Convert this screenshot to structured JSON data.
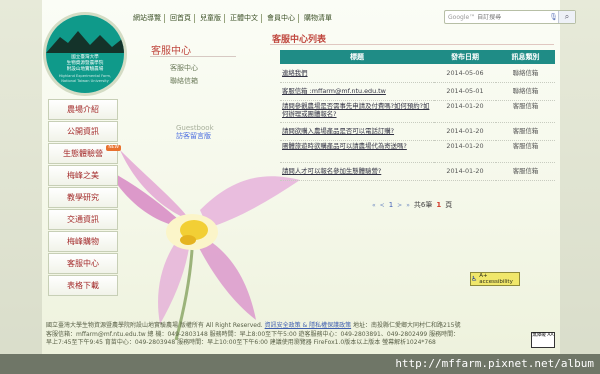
{
  "topnav": [
    "網站導覽",
    "回首頁",
    "兒童版",
    "正體中文",
    "會員中心",
    "購物清單"
  ],
  "search": {
    "google_label": "Google™",
    "placeholder": "自訂搜尋"
  },
  "logo": {
    "title_lines": [
      "國立臺灣大學",
      "生物資源暨農學院",
      "附設山地實驗農場"
    ],
    "subtitle": "Highland Experimental Farm, National Taiwan University"
  },
  "sidemenu": [
    {
      "label": "農場介紹"
    },
    {
      "label": "公開資訊"
    },
    {
      "label": "生態體驗營",
      "badge": "NEW"
    },
    {
      "label": "梅峰之美"
    },
    {
      "label": "教學研究"
    },
    {
      "label": "交通資訊"
    },
    {
      "label": "梅峰購物"
    },
    {
      "label": "客服中心"
    },
    {
      "label": "表格下載"
    }
  ],
  "subpanel": {
    "title": "客服中心",
    "links": [
      "客服中心",
      "聯絡信箱"
    ]
  },
  "guestbook": {
    "en": "Guestbook",
    "zh": "訪客留言版"
  },
  "content": {
    "title": "客服中心列表",
    "headers": [
      "標題",
      "發布日期",
      "訊息類別"
    ],
    "rows": [
      {
        "title": "連絡我們",
        "date": "2014-05-06",
        "category": "聯絡信箱"
      },
      {
        "title": "客服信箱 :mffarm@mf.ntu.edu.tw",
        "date": "2014-05-01",
        "category": "聯絡信箱"
      },
      {
        "title": "請問參觀農場是否需事先申請及付費嗎?如何預約?如何辦理或團體報名?",
        "date": "2014-01-20",
        "category": "客服信箱"
      },
      {
        "title": "請問欲購入農場產品是否可以電話訂購?",
        "date": "2014-01-20",
        "category": "客服信箱"
      },
      {
        "title": "團體旅遊時欲購產品可以請農場代為寄送嗎?",
        "date": "2014-01-20",
        "category": "客服信箱"
      },
      {
        "title": "請問人才可以報名參加生態體驗營?",
        "date": "2014-01-20",
        "category": "客服信箱"
      }
    ],
    "pager": {
      "first": "«",
      "prev": "<",
      "page": "1",
      "next": ">",
      "last": "»",
      "total_text": "共6筆",
      "current": "1",
      "suffix": "頁"
    }
  },
  "access_badge": "A+ accessibility",
  "aa_badge": "無障礙 AA",
  "footer": {
    "line1": "國立臺灣大學生物資源暨農學院附設山地實驗農場 版權所有 All Right Reserved.",
    "link1": "資訊安全政策 & 隱私權保護政策",
    "line1b": "地址：南投縣仁愛鄉大同村仁和路215號",
    "line2": "客服信箱：mffarm@mf.ntu.edu.tw 總 機：049-2803148 服務時間：早上8:00至下午5:00 遊客服務中心：049-2803891、049-2802499 服務時間：",
    "line3": "早上7:45至下午9:45 育苗中心：049-2803948 服務時間：早上10:00至下午6:00 建議使用瀏覽器 FireFox1.0版本以上版本 螢幕解析1024*768"
  },
  "watermark": "http://mffarm.pixnet.net/album",
  "colors": {
    "teal": "#1f8c86",
    "red_title": "#c0473e",
    "page_bg": "#f5f8ea"
  }
}
